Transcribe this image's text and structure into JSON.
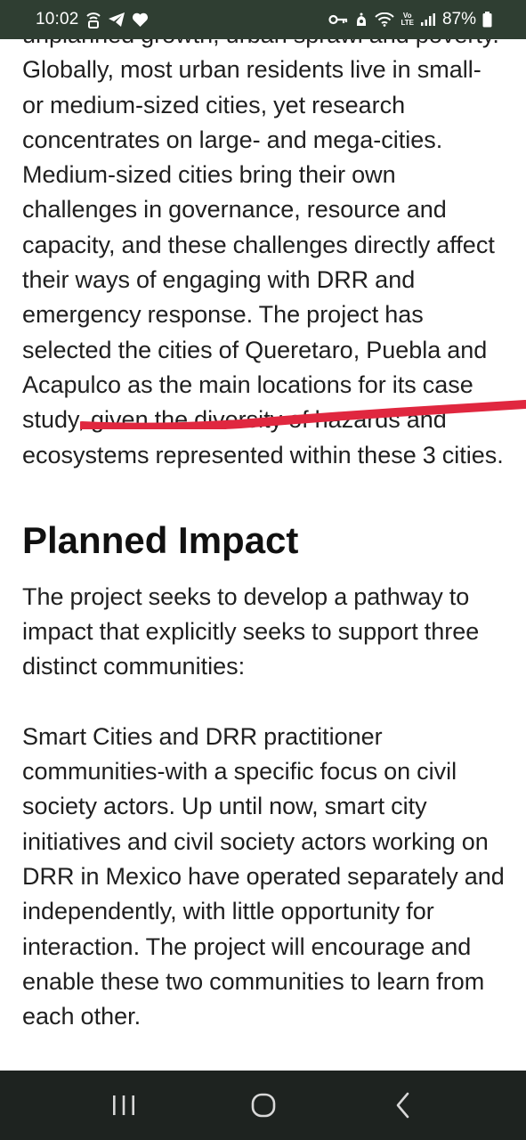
{
  "status_bar": {
    "time": "10:02",
    "battery_percent": "87%",
    "network_label_top": "Vo",
    "network_label_bottom": "LTE",
    "icons": [
      "cast-icon",
      "telegram-icon",
      "heart-icon",
      "key-icon",
      "alarm-icon",
      "wifi-icon",
      "signal-icon",
      "battery-icon"
    ]
  },
  "article": {
    "paragraph_1": "unplanned growth, urban sprawl and poverty. Globally, most urban residents live in small- or medium-sized cities, yet research concentrates on large- and mega-cities. Medium-sized cities bring their own challenges in governance, resource and capacity, and these challenges directly affect their ways of engaging with DRR and emergency response. The project has selected the cities of Queretaro, Puebla and Acapulco as the main locations for its case study, given the diversity of hazards and ecosystems represented within these 3 cities.",
    "heading": "Planned Impact",
    "paragraph_2": "The project seeks to develop a pathway to impact that explicitly seeks to support three distinct communities:",
    "paragraph_3": "Smart Cities and DRR practitioner communities-with a specific focus on civil society actors. Up until now, smart city initiatives and civil society actors working on DRR in Mexico have operated separately and independently, with little opportunity for interaction. The project will encourage and enable these two communities to learn from each other."
  },
  "markup": {
    "color": "#e0273f"
  },
  "nav_bar": {
    "buttons": [
      "recent-apps-icon",
      "home-icon",
      "back-icon"
    ]
  }
}
